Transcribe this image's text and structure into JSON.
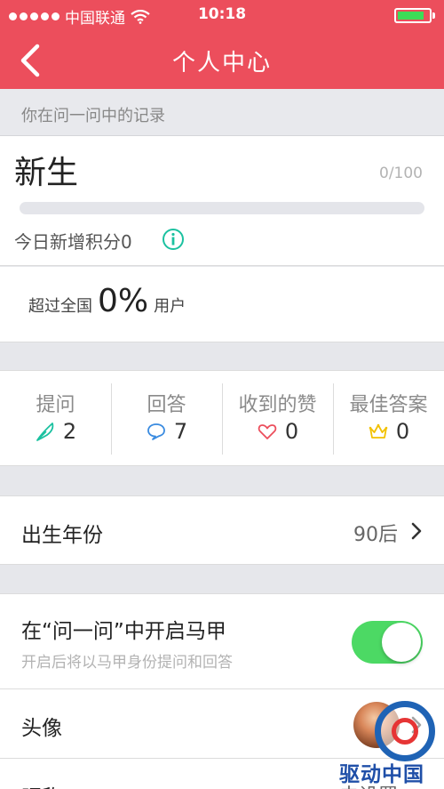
{
  "status_bar": {
    "carrier": "中国联通",
    "time": "10:18",
    "battery_level": 0.85,
    "signal_dots": 5
  },
  "nav": {
    "title": "个人中心",
    "back_icon": "chevron-left-icon"
  },
  "section_caption": "你在问一问中的记录",
  "level": {
    "name": "新生",
    "progress_text": "0/100",
    "progress_fraction": 0,
    "today_points": "今日新增积分0",
    "info_icon": "info-circle-icon"
  },
  "rank": {
    "prefix": "超过全国",
    "value": "0%",
    "suffix": "用户"
  },
  "stats": [
    {
      "label": "提问",
      "value": "2",
      "icon": "feather-icon"
    },
    {
      "label": "回答",
      "value": "7",
      "icon": "speech-bubble-icon"
    },
    {
      "label": "收到的赞",
      "value": "0",
      "icon": "heart-icon"
    },
    {
      "label": "最佳答案",
      "value": "0",
      "icon": "crown-icon"
    }
  ],
  "birth": {
    "label": "出生年份",
    "value": "90后"
  },
  "mask": {
    "title": "在“问一问”中开启马甲",
    "hint": "开启后将以马甲身份提问和回答",
    "enabled": true
  },
  "avatar_row": {
    "label": "头像"
  },
  "nickname_row": {
    "label": "昵称",
    "value": "未设置"
  },
  "watermark": {
    "text": "驱动中国"
  },
  "colors": {
    "brand": "#ec4e5c",
    "toggle_on": "#4cd964",
    "info": "#1bc1a0"
  }
}
